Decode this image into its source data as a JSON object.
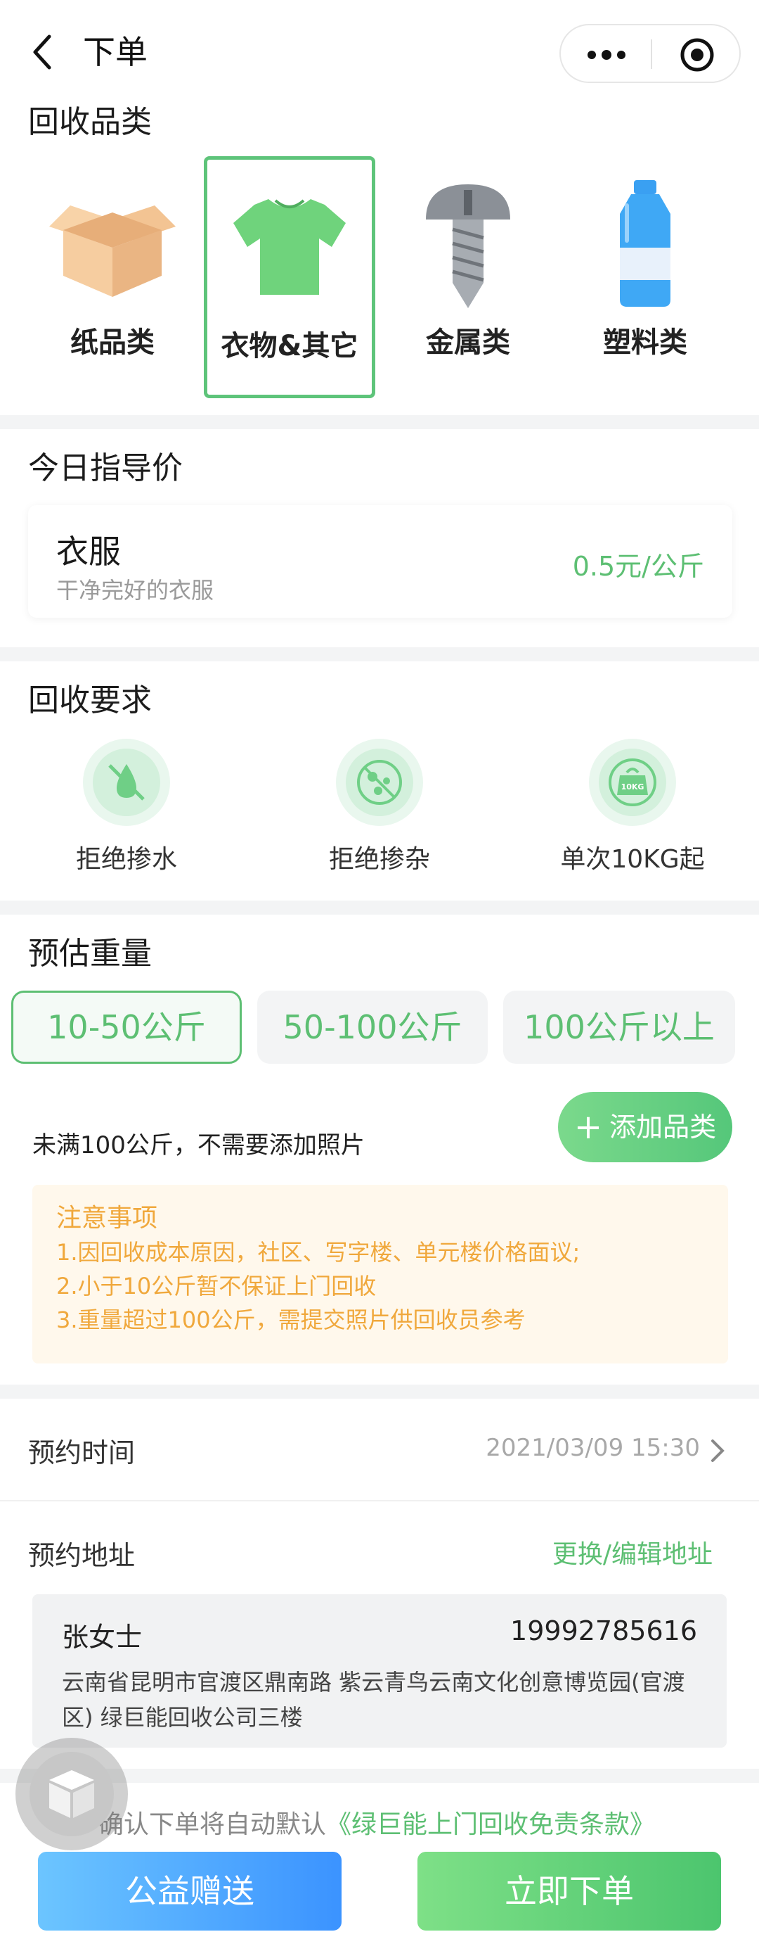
{
  "header": {
    "title": "下单",
    "back_icon": "chevron-left-icon",
    "more_icon": "more-dots-icon",
    "close_icon": "target-icon"
  },
  "categories": {
    "title": "回收品类",
    "items": [
      {
        "label": "纸品类",
        "icon": "cardboard-box-icon",
        "selected": false
      },
      {
        "label": "衣物&其它",
        "icon": "tshirt-icon",
        "selected": true
      },
      {
        "label": "金属类",
        "icon": "screw-icon",
        "selected": false
      },
      {
        "label": "塑料类",
        "icon": "plastic-bottle-icon",
        "selected": false
      }
    ]
  },
  "price": {
    "title": "今日指导价",
    "item_name": "衣服",
    "item_desc": "干净完好的衣服",
    "value": "0.5元/公斤"
  },
  "requirements": {
    "title": "回收要求",
    "items": [
      {
        "label": "拒绝掺水",
        "icon": "no-water-icon"
      },
      {
        "label": "拒绝掺杂",
        "icon": "no-impurities-icon"
      },
      {
        "label": "单次10KG起",
        "icon": "weight-10kg-icon",
        "badge": "10KG"
      }
    ]
  },
  "weight": {
    "title": "预估重量",
    "options": [
      {
        "label": "10-50公斤",
        "selected": true
      },
      {
        "label": "50-100公斤",
        "selected": false
      },
      {
        "label": "100公斤以上",
        "selected": false
      }
    ],
    "hint": "未满100公斤，不需要添加照片",
    "add_button": "添加品类"
  },
  "notice": {
    "title": "注意事项",
    "lines": [
      "1.因回收成本原因，社区、写字楼、单元楼价格面议;",
      "2.小于10公斤暂不保证上门回收",
      "3.重量超过100公斤，需提交照片供回收员参考"
    ]
  },
  "appointment": {
    "label": "预约时间",
    "value": "2021/03/09 15:30"
  },
  "address": {
    "label": "预约地址",
    "edit_link": "更换/编辑地址",
    "name": "张女士",
    "phone": "19992785616",
    "line": "云南省昆明市官渡区鼎南路 紫云青鸟云南文化创意博览园(官渡区) 绿巨能回收公司三楼"
  },
  "terms": {
    "prefix": "确认下单将自动默认",
    "link": "《绿巨能上门回收免责条款》"
  },
  "buttons": {
    "donate": "公益赠送",
    "order": "立即下单"
  },
  "colors": {
    "accent_green": "#5dbf73",
    "notice_orange": "#f0a83c",
    "donate_blue": "#3b93ff"
  }
}
